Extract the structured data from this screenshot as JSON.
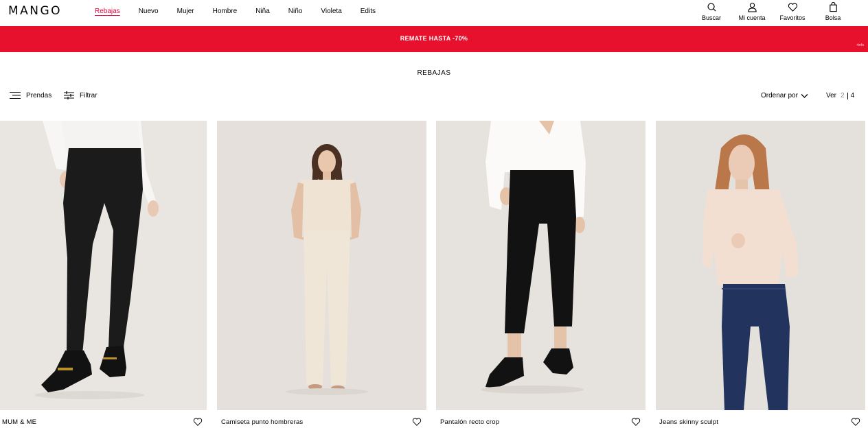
{
  "header": {
    "logo": "MANGO",
    "nav": [
      "Rebajas",
      "Nuevo",
      "Mujer",
      "Hombre",
      "Niña",
      "Niño",
      "Violeta",
      "Edits"
    ],
    "active_nav": "Rebajas",
    "utilities": {
      "search": {
        "label": "Buscar",
        "icon": "search-icon"
      },
      "account": {
        "label": "Mi cuenta",
        "icon": "user-icon"
      },
      "favorites": {
        "label": "Favoritos",
        "icon": "heart-icon"
      },
      "bag": {
        "label": "Bolsa",
        "icon": "bag-icon"
      }
    }
  },
  "promo": {
    "text": "REMATE HASTA -70%",
    "small": "+info",
    "color": "#e8112d"
  },
  "page": {
    "title": "REBAJAS"
  },
  "toolbar": {
    "garments_label": "Prendas",
    "filter_label": "Filtrar",
    "order_label": "Ordenar por",
    "view_label": "Ver",
    "view_options": [
      "2",
      "4"
    ],
    "view_selected": "4"
  },
  "products": [
    {
      "name": "MUM & ME"
    },
    {
      "name": "Camiseta punto hombreras"
    },
    {
      "name": "Pantalón recto crop"
    },
    {
      "name": "Jeans skinny sculpt"
    }
  ],
  "colors": {
    "accent": "#e7003d",
    "image_bg": "#e7e3de"
  }
}
